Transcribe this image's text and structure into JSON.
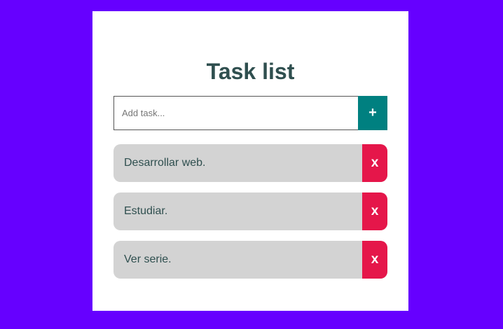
{
  "colors": {
    "page_background": "#6600ff",
    "card_background": "#ffffff",
    "title_color": "#2f4f4f",
    "add_button": "#008080",
    "task_background": "#d3d3d3",
    "delete_button": "#e5164a"
  },
  "title": "Task list",
  "add_form": {
    "input_value": "",
    "input_placeholder": "Add task...",
    "add_button_label": "+",
    "add_button_icon": "plus-icon"
  },
  "tasks": [
    {
      "text": "Desarrollar web.",
      "delete_label": "x"
    },
    {
      "text": "Estudiar.",
      "delete_label": "x"
    },
    {
      "text": "Ver serie.",
      "delete_label": "x"
    }
  ]
}
